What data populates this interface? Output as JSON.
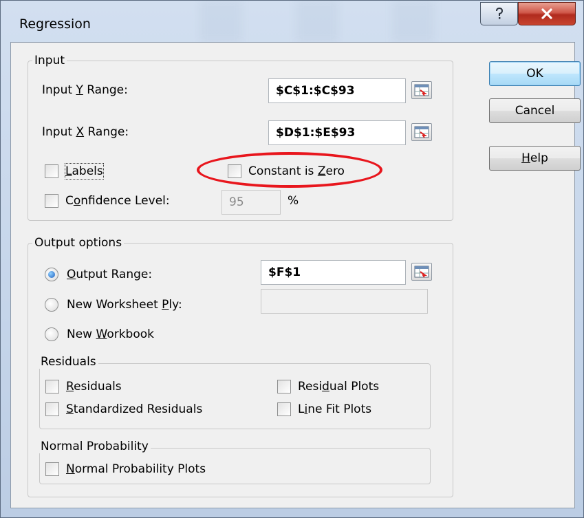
{
  "window": {
    "title": "Regression"
  },
  "input_group": {
    "legend": "Input",
    "y_range_label": "Input Y Range:",
    "y_range_value": "$C$1:$C$93",
    "x_range_label": "Input X Range:",
    "x_range_value": "$D$1:$E$93",
    "labels_label": "Labels",
    "labels_checked": false,
    "constant_zero_label": "Constant is Zero",
    "constant_zero_checked": false,
    "confidence_label": "Confidence Level:",
    "confidence_value": "95",
    "confidence_unit": "%",
    "confidence_checked": false
  },
  "output_group": {
    "legend": "Output options",
    "output_range_label": "Output Range:",
    "output_range_value": "$F$1",
    "new_worksheet_label": "New Worksheet Ply:",
    "new_worksheet_value": "",
    "new_workbook_label": "New Workbook",
    "selected": "Output Range"
  },
  "residuals_group": {
    "legend": "Residuals",
    "residuals_label": "Residuals",
    "standardized_label": "Standardized Residuals",
    "residual_plots_label": "Residual Plots",
    "line_fit_label": "Line Fit Plots"
  },
  "normal_group": {
    "legend": "Normal Probability",
    "plots_label": "Normal Probability Plots"
  },
  "buttons": {
    "ok": "OK",
    "cancel": "Cancel",
    "help": "Help"
  },
  "icons": {
    "range_picker": "range-selector-icon",
    "help": "question-mark-icon",
    "close": "close-x-icon"
  },
  "colors": {
    "annotation": "#e8161d",
    "default_button": "#3c7fb1",
    "title_bar": "#c5d5ea"
  }
}
